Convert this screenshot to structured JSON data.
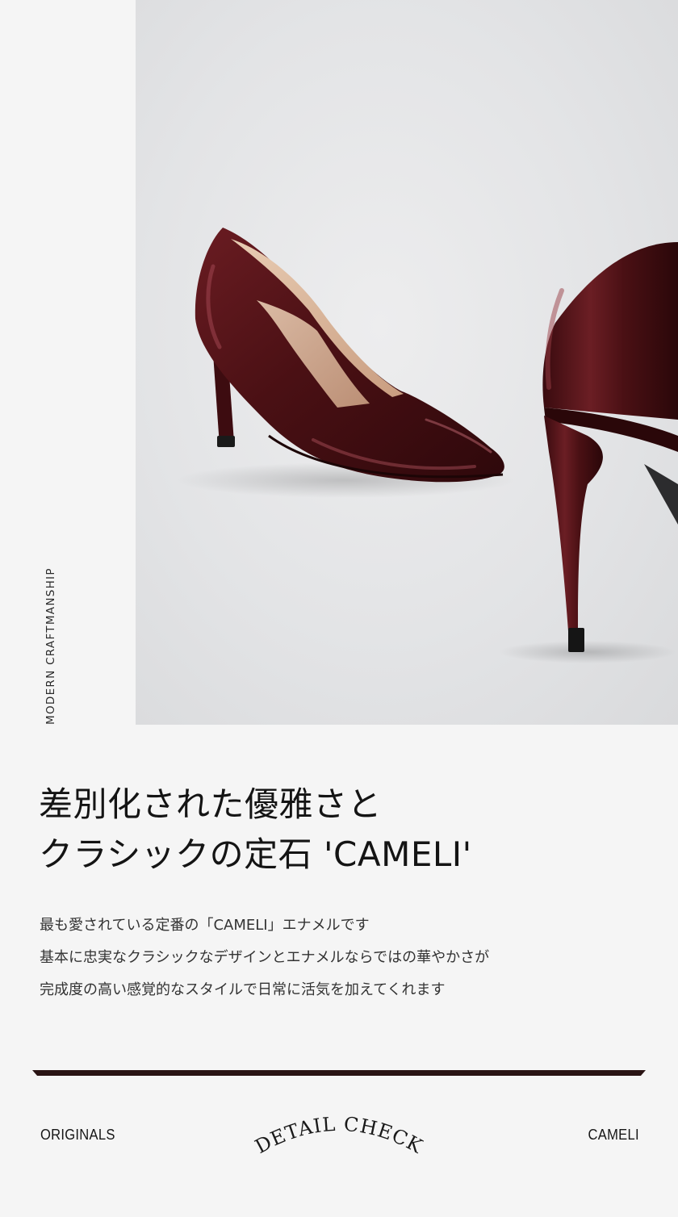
{
  "side_caption": "MODERN CRAFTMANSHIP",
  "headline": {
    "line1": "差別化された優雅さと",
    "line2": "クラシックの定石 'CAMELI'"
  },
  "description": {
    "line1": "最も愛されている定番の「CAMELI」エナメルです",
    "line2": "基本に忠実なクラシックなデザインとエナメルならではの華やかさが",
    "line3": "完成度の高い感覚的なスタイルで日常に活気を加えてくれます"
  },
  "footer": {
    "left": "ORIGINALS",
    "center": "DETAIL CHECK",
    "right": "CAMELI"
  },
  "colors": {
    "background": "#f5f5f5",
    "divider": "#2a1414",
    "shoe": "#4a1014"
  }
}
